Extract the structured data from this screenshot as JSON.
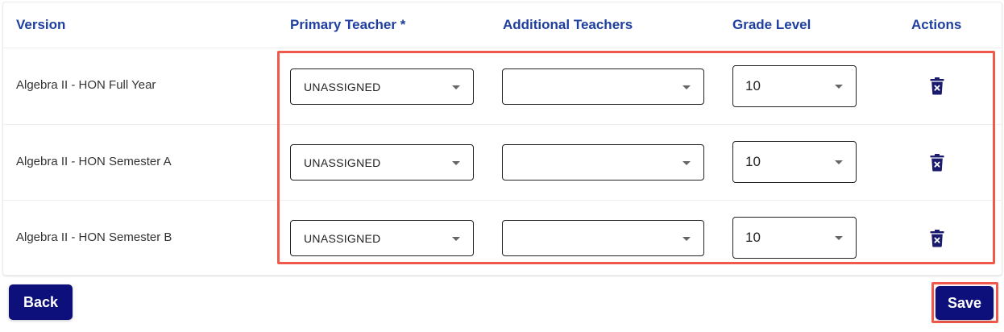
{
  "table": {
    "headers": {
      "version": "Version",
      "primary_teacher": "Primary Teacher *",
      "additional_teachers": "Additional Teachers",
      "grade_level": "Grade Level",
      "actions": "Actions"
    },
    "rows": [
      {
        "version": "Algebra II - HON Full Year",
        "primary_teacher": "UNASSIGNED",
        "additional_teachers": "",
        "grade_level": "10",
        "delete_icon": "trash-icon"
      },
      {
        "version": "Algebra II - HON Semester A",
        "primary_teacher": "UNASSIGNED",
        "additional_teachers": "",
        "grade_level": "10",
        "delete_icon": "trash-icon"
      },
      {
        "version": "Algebra II - HON Semester B",
        "primary_teacher": "UNASSIGNED",
        "additional_teachers": "",
        "grade_level": "10",
        "delete_icon": "trash-icon"
      }
    ]
  },
  "footer": {
    "back_label": "Back",
    "save_label": "Save"
  },
  "colors": {
    "header_text": "#1f3fa0",
    "button_bg": "#0d0f7a",
    "highlight": "#f0584c",
    "icon": "#1a1a6e"
  }
}
